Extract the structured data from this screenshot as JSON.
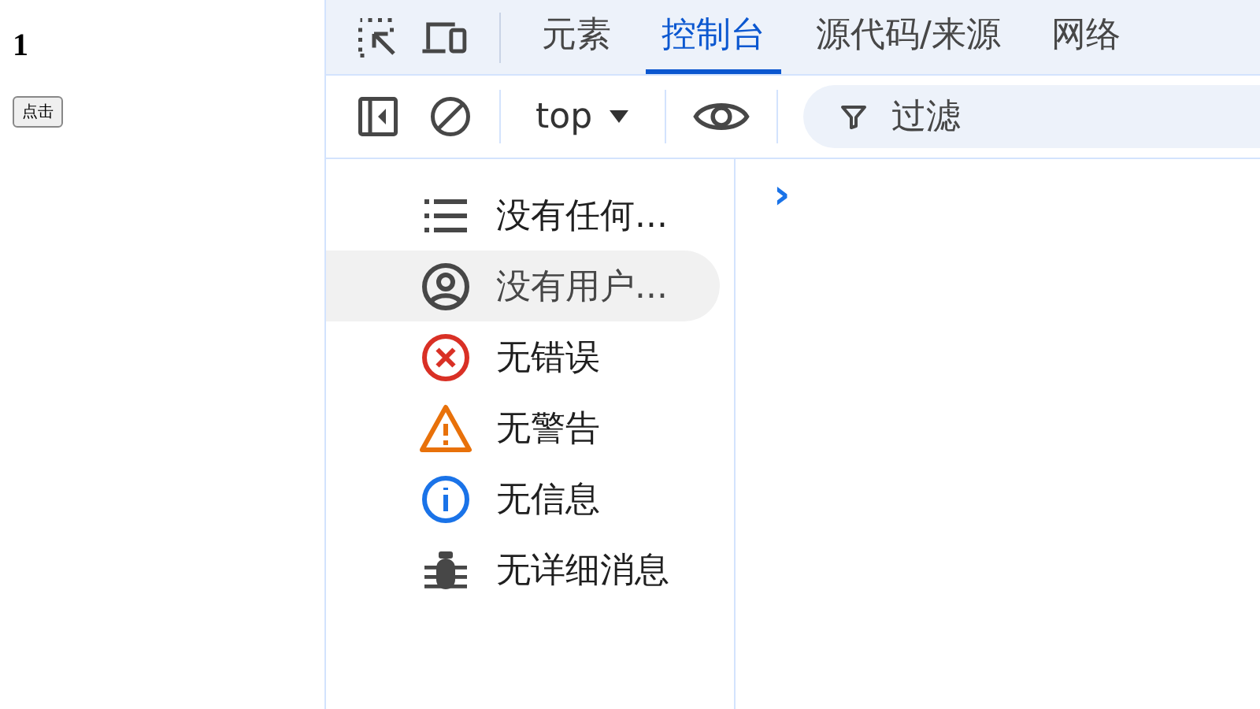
{
  "page": {
    "heading": "1",
    "button": "点击"
  },
  "devtools": {
    "tabs": [
      {
        "label": "元素",
        "selected": false
      },
      {
        "label": "控制台",
        "selected": true
      },
      {
        "label": "源代码/来源",
        "selected": false
      },
      {
        "label": "网络",
        "selected": false
      }
    ],
    "toolbar": {
      "context": "top",
      "filter_placeholder": "过滤"
    },
    "sidebar": {
      "items": [
        {
          "kind": "list",
          "label": "没有任何...",
          "selected": false
        },
        {
          "kind": "user",
          "label": "没有用户...",
          "selected": true
        },
        {
          "kind": "error",
          "label": "无错误",
          "selected": false
        },
        {
          "kind": "warning",
          "label": "无警告",
          "selected": false
        },
        {
          "kind": "info",
          "label": "无信息",
          "selected": false
        },
        {
          "kind": "verbose",
          "label": "无详细消息",
          "selected": false
        }
      ]
    },
    "console": {
      "prompt": "›"
    }
  }
}
